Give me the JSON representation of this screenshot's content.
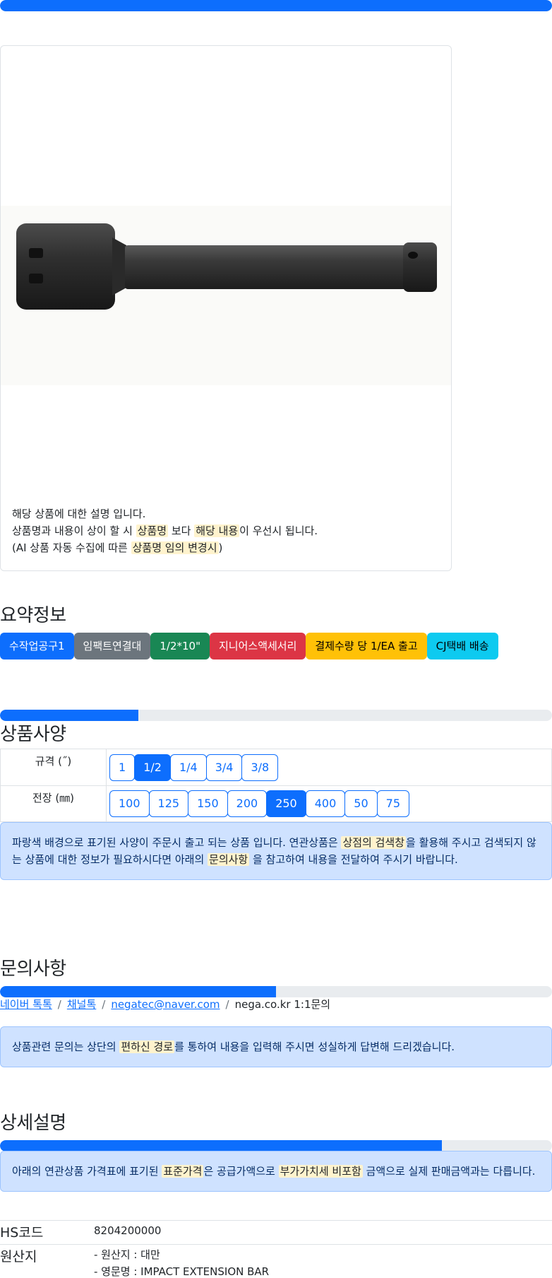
{
  "top_progress": {
    "percent": 100
  },
  "product_card": {
    "image_alt": "IMPACT EXTENSION BAR",
    "desc_line1": "해당 상품에 대한 설명 입니다.",
    "desc_line2_a": "상품명과 내용이 상이 할 시 ",
    "desc_line2_hl1": "상품명",
    "desc_line2_b": " 보다 ",
    "desc_line2_hl2": "해당 내용",
    "desc_line2_c": "이 우선시 됩니다.",
    "desc_line3_a": "(AI 상품 자동 수집에 따른 ",
    "desc_line3_hl": "상품명 임의 변경시",
    "desc_line3_b": ")"
  },
  "summary": {
    "title": "요약정보",
    "tags": [
      {
        "label": "수작업공구1",
        "bg": "#0d6efd",
        "fg": "#ffffff"
      },
      {
        "label": "임팩트연결대",
        "bg": "#6c757d",
        "fg": "#ffffff"
      },
      {
        "label": "1/2*10\"",
        "bg": "#198754",
        "fg": "#ffffff"
      },
      {
        "label": "지니어스액세서리",
        "bg": "#dc3545",
        "fg": "#ffffff"
      },
      {
        "label": "결제수량 당 1/EA 출고",
        "bg": "#ffc107",
        "fg": "#000000"
      },
      {
        "label": "CJ택배 배송",
        "bg": "#0dcaf0",
        "fg": "#000000"
      }
    ]
  },
  "spec": {
    "progress_percent": 25,
    "title": "상품사양",
    "rows": [
      {
        "label": "규격 (˝)",
        "options": [
          "1",
          "1/2",
          "1/4",
          "3/4",
          "3/8"
        ],
        "selected": "1/2"
      },
      {
        "label": "전장 (㎜)",
        "options": [
          "100",
          "125",
          "150",
          "200",
          "250",
          "400",
          "50",
          "75"
        ],
        "selected": "250"
      }
    ],
    "notice_a": "파랑색 배경으로 표기된 사양이 주문시 출고 되는 상품 입니다. 연관상품은 ",
    "notice_hl1": "상점의 검색창",
    "notice_b": "을 활용해 주시고 검색되지 않는 상품에 대한 정보가 필요하시다면 아래의 ",
    "notice_hl2": "문의사항",
    "notice_c": " 을 참고하여 내용을 전달하여 주시기 바랍니다."
  },
  "inquiry": {
    "title": "문의사항",
    "progress_percent": 50,
    "links": [
      "네이버 톡톡",
      "채널톡",
      "negatec@naver.com"
    ],
    "plain": "nega.co.kr 1:1문의",
    "notice_a": "상품관련 문의는 상단의 ",
    "notice_hl": "편하신 경로",
    "notice_b": "를 통하여 내용을 입력해 주시면 성실하게 답변해 드리겠습니다."
  },
  "detail": {
    "title": "상세설명",
    "progress_percent": 80,
    "notice_a": "아래의 연관상품 가격표에 표기된 ",
    "notice_hl1": "표준가격",
    "notice_b": "은 공급가액으로 ",
    "notice_hl2": "부가가치세 비포함",
    "notice_c": " 금액으로 실제 판매금액과는 다릅니다.",
    "rows": [
      {
        "key": "HS코드",
        "values": [
          "8204200000"
        ]
      },
      {
        "key": "원산지",
        "values": [
          "- 원산지 : 대만",
          "- 영문명 : IMPACT EXTENSION BAR"
        ]
      }
    ]
  }
}
